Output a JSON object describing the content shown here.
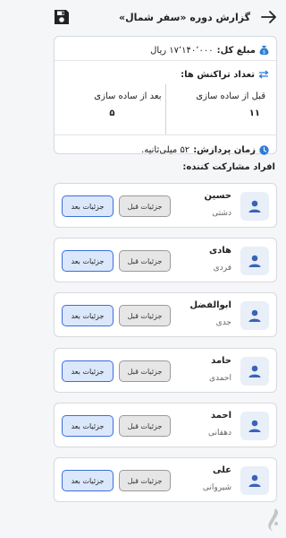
{
  "header": {
    "title": "گزارش دوره «سفر شمال»",
    "back_icon": "arrow-right-icon",
    "save_icon": "floppy-disk-icon"
  },
  "summary": {
    "total_label": "مبلغ کل:",
    "total_value": "۱۷٬۱۴۰٬۰۰۰ ریال",
    "transactions_label": "تعداد تراکنش ها:",
    "before_label": "قبل از ساده سازی",
    "before_value": "۱۱",
    "after_label": "بعد از ساده سازی",
    "after_value": "۵",
    "processing_label": "زمان پردازش:",
    "processing_value": "۵۲ میلی‌ثانیه."
  },
  "participants_title": "افراد مشارکت کننده:",
  "buttons": {
    "before": "جزئیات قبل",
    "after": "جزئیات بعد"
  },
  "participants": [
    {
      "name": "حسین",
      "family": "دشتی"
    },
    {
      "name": "هادی",
      "family": "فردی"
    },
    {
      "name": "ابوالفضل",
      "family": "جدی"
    },
    {
      "name": "حامد",
      "family": "احمدی"
    },
    {
      "name": "احمد",
      "family": "دهقانی"
    },
    {
      "name": "علی",
      "family": "شیروانی"
    }
  ],
  "colors": {
    "accent": "#3b6fd8",
    "avatar_bg": "#e8eff8",
    "avatar_icon": "#3a63b8",
    "money_icon": "#2e7dd6"
  }
}
